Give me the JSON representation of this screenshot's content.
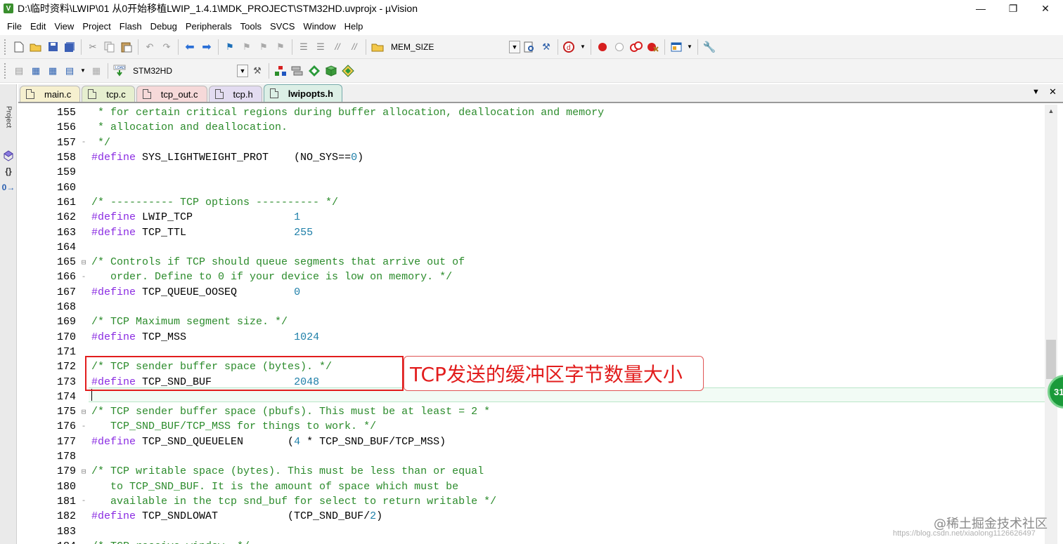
{
  "window": {
    "title": "D:\\临时资料\\LWIP\\01 从0开始移植LWIP_1.4.1\\MDK_PROJECT\\STM32HD.uvprojx - µVision",
    "icon_letter": "V",
    "minimize": "—",
    "restore": "❐",
    "close": "✕"
  },
  "menu": [
    "File",
    "Edit",
    "View",
    "Project",
    "Flash",
    "Debug",
    "Peripherals",
    "Tools",
    "SVCS",
    "Window",
    "Help"
  ],
  "toolbar1": {
    "find_combo_value": "MEM_SIZE"
  },
  "toolbar2": {
    "target_combo_value": "STM32HD",
    "load_label": "LOAD"
  },
  "sidebar": {
    "project_label": "Project",
    "braces": "{}",
    "templates": "0→"
  },
  "tabs": [
    {
      "label": "main.c",
      "color": "#f6f0cf",
      "active": false
    },
    {
      "label": "tcp.c",
      "color": "#e6efcf",
      "active": false
    },
    {
      "label": "tcp_out.c",
      "color": "#f6d9d9",
      "active": false
    },
    {
      "label": "tcp.h",
      "color": "#e3dcf1",
      "active": false
    },
    {
      "label": "lwipopts.h",
      "color": "#dcefe6",
      "active": true
    }
  ],
  "tab_controls": {
    "dropdown": "▼",
    "close": "✕"
  },
  "code_lines": [
    {
      "n": "155",
      "f": "",
      "segs": [
        {
          "c": "cm",
          "t": " * for certain critical regions during buffer allocation, deallocation and memory"
        }
      ]
    },
    {
      "n": "156",
      "f": "",
      "segs": [
        {
          "c": "cm",
          "t": " * allocation and deallocation."
        }
      ]
    },
    {
      "n": "157",
      "f": "-",
      "segs": [
        {
          "c": "cm",
          "t": " */"
        }
      ]
    },
    {
      "n": "158",
      "f": "",
      "segs": [
        {
          "c": "pp",
          "t": "#define"
        },
        {
          "c": "",
          "t": " SYS_LIGHTWEIGHT_PROT    (NO_SYS=="
        },
        {
          "c": "nm",
          "t": "0"
        },
        {
          "c": "",
          "t": ")"
        }
      ]
    },
    {
      "n": "159",
      "f": "",
      "segs": []
    },
    {
      "n": "160",
      "f": "",
      "segs": []
    },
    {
      "n": "161",
      "f": "",
      "segs": [
        {
          "c": "cm",
          "t": "/* ---------- TCP options ---------- */"
        }
      ]
    },
    {
      "n": "162",
      "f": "",
      "segs": [
        {
          "c": "pp",
          "t": "#define"
        },
        {
          "c": "",
          "t": " LWIP_TCP                "
        },
        {
          "c": "nm",
          "t": "1"
        }
      ]
    },
    {
      "n": "163",
      "f": "",
      "segs": [
        {
          "c": "pp",
          "t": "#define"
        },
        {
          "c": "",
          "t": " TCP_TTL                 "
        },
        {
          "c": "nm",
          "t": "255"
        }
      ]
    },
    {
      "n": "164",
      "f": "",
      "segs": []
    },
    {
      "n": "165",
      "f": "⊟",
      "segs": [
        {
          "c": "cm",
          "t": "/* Controls if TCP should queue segments that arrive out of"
        }
      ]
    },
    {
      "n": "166",
      "f": "-",
      "segs": [
        {
          "c": "cm",
          "t": "   order. Define to 0 if your device is low on memory. */"
        }
      ]
    },
    {
      "n": "167",
      "f": "",
      "segs": [
        {
          "c": "pp",
          "t": "#define"
        },
        {
          "c": "",
          "t": " TCP_QUEUE_OOSEQ         "
        },
        {
          "c": "nm",
          "t": "0"
        }
      ]
    },
    {
      "n": "168",
      "f": "",
      "segs": []
    },
    {
      "n": "169",
      "f": "",
      "segs": [
        {
          "c": "cm",
          "t": "/* TCP Maximum segment size. */"
        }
      ]
    },
    {
      "n": "170",
      "f": "",
      "segs": [
        {
          "c": "pp",
          "t": "#define"
        },
        {
          "c": "",
          "t": " TCP_MSS                 "
        },
        {
          "c": "nm",
          "t": "1024"
        }
      ]
    },
    {
      "n": "171",
      "f": "",
      "segs": []
    },
    {
      "n": "172",
      "f": "",
      "segs": [
        {
          "c": "cm",
          "t": "/* TCP sender buffer space (bytes). */"
        }
      ]
    },
    {
      "n": "173",
      "f": "",
      "segs": [
        {
          "c": "pp",
          "t": "#define"
        },
        {
          "c": "",
          "t": " TCP_SND_BUF             "
        },
        {
          "c": "nm",
          "t": "2048"
        }
      ]
    },
    {
      "n": "174",
      "f": "",
      "segs": []
    },
    {
      "n": "175",
      "f": "⊟",
      "segs": [
        {
          "c": "cm",
          "t": "/* TCP sender buffer space (pbufs). This must be at least = 2 *"
        }
      ]
    },
    {
      "n": "176",
      "f": "-",
      "segs": [
        {
          "c": "cm",
          "t": "   TCP_SND_BUF/TCP_MSS for things to work. */"
        }
      ]
    },
    {
      "n": "177",
      "f": "",
      "segs": [
        {
          "c": "pp",
          "t": "#define"
        },
        {
          "c": "",
          "t": " TCP_SND_QUEUELEN       ("
        },
        {
          "c": "nm",
          "t": "4"
        },
        {
          "c": "",
          "t": " * TCP_SND_BUF/TCP_MSS)"
        }
      ]
    },
    {
      "n": "178",
      "f": "",
      "segs": []
    },
    {
      "n": "179",
      "f": "⊟",
      "segs": [
        {
          "c": "cm",
          "t": "/* TCP writable space (bytes). This must be less than or equal"
        }
      ]
    },
    {
      "n": "180",
      "f": "",
      "segs": [
        {
          "c": "cm",
          "t": "   to TCP_SND_BUF. It is the amount of space which must be"
        }
      ]
    },
    {
      "n": "181",
      "f": "-",
      "segs": [
        {
          "c": "cm",
          "t": "   available in the tcp snd_buf for select to return writable */"
        }
      ]
    },
    {
      "n": "182",
      "f": "",
      "segs": [
        {
          "c": "pp",
          "t": "#define"
        },
        {
          "c": "",
          "t": " TCP_SNDLOWAT           (TCP_SND_BUF/"
        },
        {
          "c": "nm",
          "t": "2"
        },
        {
          "c": "",
          "t": ")"
        }
      ]
    },
    {
      "n": "183",
      "f": "",
      "segs": []
    },
    {
      "n": "184",
      "f": "",
      "segs": [
        {
          "c": "cm",
          "t": "/* TCP receive window. */"
        }
      ]
    }
  ],
  "annotation": {
    "callout_text": "TCP发送的缓冲区字节数量大小"
  },
  "badge": "31",
  "watermark": "@稀土掘金技术社区",
  "watermark_url": "https://blog.csdn.net/xiaolong1126626497"
}
